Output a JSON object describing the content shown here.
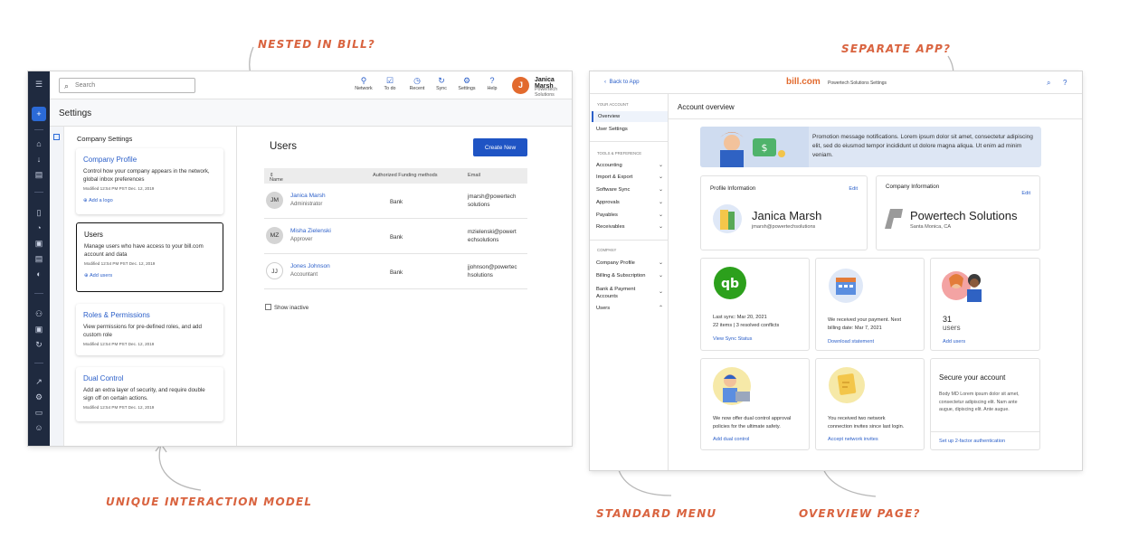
{
  "annotations": {
    "nested": "Nested in Bill?",
    "separate": "Separate App?",
    "unique": "Unique interaction model",
    "standard": "Standard menu",
    "overview": "Overview page?"
  },
  "left": {
    "search_placeholder": "Search",
    "toolbar": [
      {
        "label": "Network",
        "icon": "network-icon"
      },
      {
        "label": "To do",
        "icon": "todo-icon"
      },
      {
        "label": "Recent",
        "icon": "recent-icon"
      },
      {
        "label": "Sync",
        "icon": "sync-icon"
      },
      {
        "label": "Settings",
        "icon": "settings-icon"
      },
      {
        "label": "Help",
        "icon": "help-icon"
      }
    ],
    "user": {
      "initial": "J",
      "name": "Janica Marsh",
      "company": "Powertech Solutions"
    },
    "page_title": "Settings",
    "company_settings_title": "Company Settings",
    "cards": [
      {
        "title": "Company Profile",
        "desc": "Control how your company appears in the network, global inbox preferences",
        "meta": "Modified 12:54 PM PST Dec. 12, 2019",
        "link": "Add a logo"
      },
      {
        "title": "Users",
        "desc": "Manage users who have access to your bill.com account and data",
        "meta": "Modified 12:54 PM PST Dec. 12, 2019",
        "link": "Add users"
      },
      {
        "title": "Roles & Permissions",
        "desc": "View permissions for pre-defined roles, and add custom role",
        "meta": "Modified 12:54 PM PST Dec. 12, 2019",
        "link": ""
      },
      {
        "title": "Dual Control",
        "desc": "Add an extra layer of security, and require double sign off on certain actions.",
        "meta": "Modified 12:54 PM PST Dec. 12, 2019",
        "link": ""
      }
    ],
    "users_title": "Users",
    "create_new": "Create New",
    "columns": [
      "Name",
      "Authorized Funding methods",
      "Email"
    ],
    "rows": [
      {
        "initials": "JM",
        "name": "Janica Marsh",
        "role": "Administrator",
        "funding": "Bank",
        "email": "jmarsh@powertech solutions"
      },
      {
        "initials": "MZ",
        "name": "Misha Zielenski",
        "role": "Approver",
        "funding": "Bank",
        "email": "mzielenski@powert echsolutions"
      },
      {
        "initials": "JJ",
        "name": "Jones Johnson",
        "role": "Accountant",
        "funding": "Bank",
        "email": "jjohnson@powertec hsolutions"
      }
    ],
    "show_inactive": "Show inactive"
  },
  "right": {
    "back": "Back to App",
    "logo": "bill.com",
    "logo_sub": "Powertech Solutions Settings",
    "menu": {
      "your_account": "YOUR ACCOUNT",
      "overview": "Overview",
      "user_settings": "User Settings",
      "tools": "TOOLS & PREFERENCE",
      "tool_items": [
        "Accounting",
        "Import & Export",
        "Software Sync",
        "Approvals",
        "Payables",
        "Receivables"
      ],
      "company": "COMPANY",
      "company_items": [
        "Company Profile",
        "Billing & Subscription",
        "Bank & Payment Accounts",
        "Users"
      ]
    },
    "title": "Account overview",
    "promo": "Promotion message notifications. Lorem ipsum dolor sit amet, consectetur adipiscing elit, sed do eiusmod tempor incididunt ut dolore magna aliqua. Ut enim ad minim veniam.",
    "profile": {
      "label": "Profile Information",
      "edit": "Edit",
      "name": "Janica Marsh",
      "email": "jmarsh@powertechsolutions"
    },
    "company": {
      "label": "Company Information",
      "edit": "Edit",
      "name": "Powertech Solutions",
      "location": "Santa Monica, CA"
    },
    "sync": {
      "line1": "Last sync: Mar 20, 2021",
      "line2": "22 items  |  3 resolved conflicts",
      "link": "View Sync Status"
    },
    "payment": {
      "line1": "We received your payment. Next",
      "line2": "billing date: Mar 7, 2021",
      "link": "Download statement"
    },
    "users": {
      "count": "31",
      "label": "users",
      "link": "Add users"
    },
    "dual": {
      "line1": "We now offer dual control approval",
      "line2": "policies for the ultimate safety.",
      "link": "Add dual control"
    },
    "invites": {
      "line1": "You received two network",
      "line2": "connection invites since last login.",
      "link": "Accept network invites"
    },
    "secure": {
      "title": "Secure your account",
      "body": "Body MD Lorem ipsum dolor sit amet, consectetur adipiscing elit. Nam ante augue, dipiscing elit. Ante augue.",
      "link": "Set up 2-factor authentication"
    }
  }
}
